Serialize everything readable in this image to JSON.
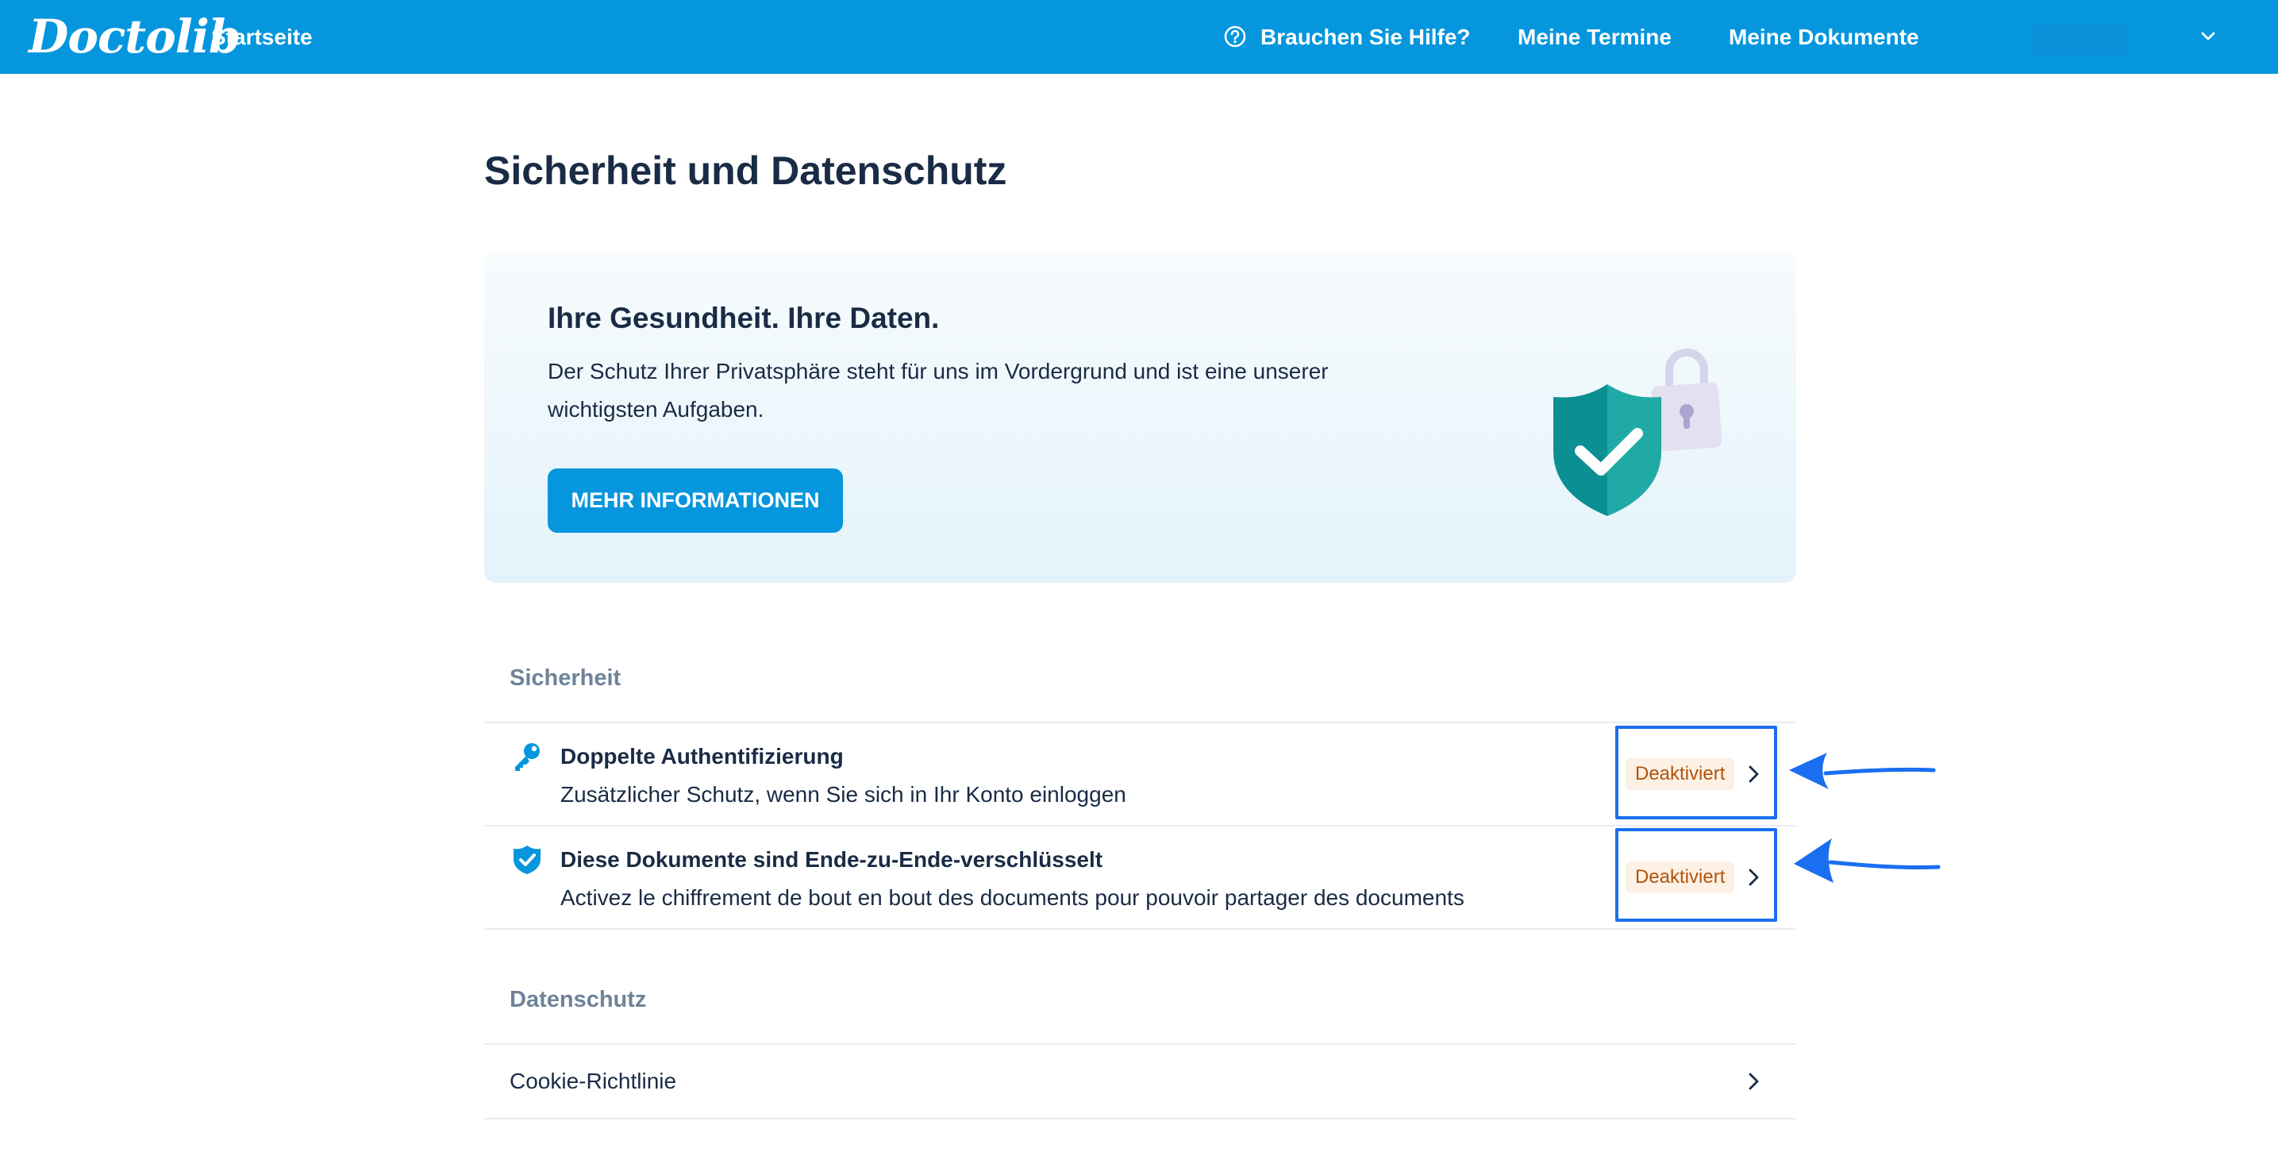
{
  "header": {
    "logo_text": "Doctolib",
    "home_label": "Startseite",
    "help_label": "Brauchen Sie Hilfe?",
    "appointments_label": "Meine Termine",
    "documents_label": "Meine Dokumente",
    "brand_color": "#0596de"
  },
  "page": {
    "title": "Sicherheit und Datenschutz"
  },
  "hero": {
    "title": "Ihre Gesundheit. Ihre Daten.",
    "text": "Der Schutz Ihrer Privatsphäre steht für uns im Vordergrund und ist eine unserer wichtigsten Aufgaben.",
    "button_label": "MEHR INFORMATIONEN",
    "illustration": "shield-check-with-padlock"
  },
  "security": {
    "heading": "Sicherheit",
    "items": [
      {
        "icon": "key-icon",
        "title": "Doppelte Authentifizierung",
        "description": "Zusätzlicher Schutz, wenn Sie sich in Ihr Konto einloggen",
        "status": "Deaktiviert"
      },
      {
        "icon": "shield-check-icon",
        "title": "Diese Dokumente sind Ende-zu-Ende-verschlüsselt",
        "description": "Activez le chiffrement de bout en bout des documents pour pouvoir partager des documents",
        "status": "Deaktiviert"
      }
    ]
  },
  "privacy": {
    "heading": "Datenschutz",
    "items": [
      {
        "label": "Cookie-Richtlinie"
      }
    ]
  },
  "colors": {
    "status_bg": "#fdf1e6",
    "status_text": "#b35309",
    "annotation_blue": "#1a6ef0"
  }
}
